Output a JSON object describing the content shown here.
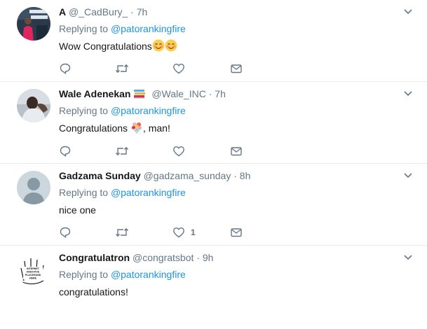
{
  "tweets": [
    {
      "name": "A",
      "handle": "@_CadBury_",
      "separator": "·",
      "time": "7h",
      "replying_prefix": "Replying to",
      "replying_to": "@patorankingfire",
      "text": "Wow Congratulations",
      "emojis": [
        "smiling-face-with-smiling-eyes",
        "smiling-face-with-smiling-eyes"
      ],
      "reply_count": "",
      "retweet_count": "",
      "like_count": ""
    },
    {
      "name": "Wale Adenekan",
      "badge": "books-emoji",
      "handle": "@Wale_INC",
      "separator": "·",
      "time": "7h",
      "replying_prefix": "Replying to",
      "replying_to": "@patorankingfire",
      "text_before": "Congratulations",
      "text_after": ", man!",
      "emojis": [
        "bouquet-emoji"
      ],
      "reply_count": "",
      "retweet_count": "",
      "like_count": ""
    },
    {
      "name": "Gadzama Sunday",
      "handle": "@gadzama_sunday",
      "separator": "·",
      "time": "8h",
      "replying_prefix": "Replying to",
      "replying_to": "@patorankingfire",
      "text": "nice one",
      "reply_count": "",
      "retweet_count": "",
      "like_count": "1"
    },
    {
      "name": "Congratulatron",
      "handle": "@congratsbot",
      "separator": "·",
      "time": "9h",
      "replying_prefix": "Replying to",
      "replying_to": "@patorankingfire",
      "text": "congratulations!",
      "avatar_sign_text": [
        "INTERNET",
        "HIGH-FIVE",
        "PLACEHAND",
        "HERE"
      ]
    }
  ],
  "colors": {
    "name": "#14171a",
    "secondary": "#657786",
    "link": "#1b95e0",
    "divider": "#e6ecf0"
  }
}
